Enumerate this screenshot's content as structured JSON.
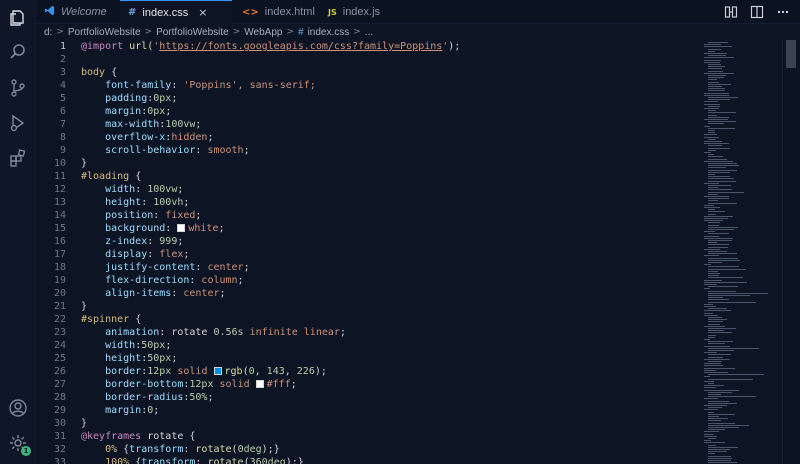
{
  "tabs": [
    {
      "label": "Welcome",
      "icon": "vscode-logo-icon"
    },
    {
      "label": "index.css",
      "icon": "css-hash-icon",
      "active": true,
      "close": "×"
    },
    {
      "label": "index.html",
      "icon": "html-brackets-icon",
      "icon_glyph": "<>"
    },
    {
      "label": "index.js",
      "icon": "js-icon",
      "icon_glyph": "JS"
    }
  ],
  "breadcrumb": [
    "d:",
    "PortfolioWebsite",
    "PortfolioWebsite",
    "WebApp",
    "index.css",
    "..."
  ],
  "breadcrumb_separator": ">",
  "breadcrumb_file_glyph": "#",
  "code": {
    "current_line": 1,
    "lines": [
      {
        "n": "1",
        "tokens": [
          [
            "@import ",
            "t-key"
          ],
          [
            "url(",
            "t-fn"
          ],
          [
            "'",
            "t-str"
          ],
          [
            "https://fonts.googleapis.com/css?family=Poppins",
            "t-url"
          ],
          [
            "'",
            "t-str"
          ],
          [
            ");",
            "t-punc"
          ]
        ]
      },
      {
        "n": "2",
        "tokens": []
      },
      {
        "n": "3",
        "tokens": [
          [
            "body",
            "t-sel"
          ],
          [
            " {",
            "t-punc"
          ]
        ]
      },
      {
        "n": "4",
        "tokens": [
          [
            "    font-family",
            "t-prop"
          ],
          [
            ": ",
            "t-punc"
          ],
          [
            "'Poppins'",
            "t-str"
          ],
          [
            ", sans-serif;",
            "t-val"
          ]
        ]
      },
      {
        "n": "5",
        "tokens": [
          [
            "    padding",
            "t-prop"
          ],
          [
            ":",
            "t-punc"
          ],
          [
            "0px",
            "t-num"
          ],
          [
            ";",
            "t-punc"
          ]
        ]
      },
      {
        "n": "6",
        "tokens": [
          [
            "    margin",
            "t-prop"
          ],
          [
            ":",
            "t-punc"
          ],
          [
            "0px",
            "t-num"
          ],
          [
            ";",
            "t-punc"
          ]
        ]
      },
      {
        "n": "7",
        "tokens": [
          [
            "    max-width",
            "t-prop"
          ],
          [
            ":",
            "t-punc"
          ],
          [
            "100vw",
            "t-num"
          ],
          [
            ";",
            "t-punc"
          ]
        ]
      },
      {
        "n": "8",
        "tokens": [
          [
            "    overflow-x",
            "t-prop"
          ],
          [
            ":",
            "t-punc"
          ],
          [
            "hidden",
            "t-val"
          ],
          [
            ";",
            "t-punc"
          ]
        ]
      },
      {
        "n": "9",
        "tokens": [
          [
            "    scroll-behavior",
            "t-prop"
          ],
          [
            ": ",
            "t-punc"
          ],
          [
            "smooth",
            "t-val"
          ],
          [
            ";",
            "t-punc"
          ]
        ]
      },
      {
        "n": "10",
        "tokens": [
          [
            "}",
            "t-punc"
          ]
        ]
      },
      {
        "n": "11",
        "tokens": [
          [
            "#loading",
            "t-sel"
          ],
          [
            " {",
            "t-punc"
          ]
        ]
      },
      {
        "n": "12",
        "tokens": [
          [
            "    width",
            "t-prop"
          ],
          [
            ": ",
            "t-punc"
          ],
          [
            "100vw",
            "t-num"
          ],
          [
            ";",
            "t-punc"
          ]
        ]
      },
      {
        "n": "13",
        "tokens": [
          [
            "    height",
            "t-prop"
          ],
          [
            ": ",
            "t-punc"
          ],
          [
            "100vh",
            "t-num"
          ],
          [
            ";",
            "t-punc"
          ]
        ]
      },
      {
        "n": "14",
        "tokens": [
          [
            "    position",
            "t-prop"
          ],
          [
            ": ",
            "t-punc"
          ],
          [
            "fixed",
            "t-val"
          ],
          [
            ";",
            "t-punc"
          ]
        ]
      },
      {
        "n": "15",
        "tokens": [
          [
            "    background",
            "t-prop"
          ],
          [
            ": ",
            "t-punc"
          ],
          [
            "#swatch:#ffffff",
            "swatch"
          ],
          [
            "white",
            "t-val"
          ],
          [
            ";",
            "t-punc"
          ]
        ]
      },
      {
        "n": "16",
        "tokens": [
          [
            "    z-index",
            "t-prop"
          ],
          [
            ": ",
            "t-punc"
          ],
          [
            "999",
            "t-num"
          ],
          [
            ";",
            "t-punc"
          ]
        ]
      },
      {
        "n": "17",
        "tokens": [
          [
            "    display",
            "t-prop"
          ],
          [
            ": ",
            "t-punc"
          ],
          [
            "flex",
            "t-val"
          ],
          [
            ";",
            "t-punc"
          ]
        ]
      },
      {
        "n": "18",
        "tokens": [
          [
            "    justify-content",
            "t-prop"
          ],
          [
            ": ",
            "t-punc"
          ],
          [
            "center",
            "t-val"
          ],
          [
            ";",
            "t-punc"
          ]
        ]
      },
      {
        "n": "19",
        "tokens": [
          [
            "    flex-direction",
            "t-prop"
          ],
          [
            ": ",
            "t-punc"
          ],
          [
            "column",
            "t-val"
          ],
          [
            ";",
            "t-punc"
          ]
        ]
      },
      {
        "n": "20",
        "tokens": [
          [
            "    align-items",
            "t-prop"
          ],
          [
            ": ",
            "t-punc"
          ],
          [
            "center",
            "t-val"
          ],
          [
            ";",
            "t-punc"
          ]
        ]
      },
      {
        "n": "21",
        "tokens": [
          [
            "}",
            "t-punc"
          ]
        ]
      },
      {
        "n": "22",
        "tokens": [
          [
            "#spinner",
            "t-sel"
          ],
          [
            " {",
            "t-punc"
          ]
        ]
      },
      {
        "n": "23",
        "tokens": [
          [
            "    animation",
            "t-prop"
          ],
          [
            ": ",
            "t-punc"
          ],
          [
            "rotate",
            "t-punc"
          ],
          [
            " 0.56s",
            "t-num"
          ],
          [
            " infinite linear",
            "t-val"
          ],
          [
            ";",
            "t-punc"
          ]
        ]
      },
      {
        "n": "24",
        "tokens": [
          [
            "    width",
            "t-prop"
          ],
          [
            ":",
            "t-punc"
          ],
          [
            "50px",
            "t-num"
          ],
          [
            ";",
            "t-punc"
          ]
        ]
      },
      {
        "n": "25",
        "tokens": [
          [
            "    height",
            "t-prop"
          ],
          [
            ":",
            "t-punc"
          ],
          [
            "50px",
            "t-num"
          ],
          [
            ";",
            "t-punc"
          ]
        ]
      },
      {
        "n": "26",
        "tokens": [
          [
            "    border",
            "t-prop"
          ],
          [
            ":",
            "t-punc"
          ],
          [
            "12px",
            "t-num"
          ],
          [
            " solid ",
            "t-val"
          ],
          [
            "#swatch:#008fe2",
            "swatch"
          ],
          [
            "rgb",
            "t-fn"
          ],
          [
            "(",
            "t-punc"
          ],
          [
            "0",
            "t-num"
          ],
          [
            ", ",
            "t-punc"
          ],
          [
            "143",
            "t-num"
          ],
          [
            ", ",
            "t-punc"
          ],
          [
            "226",
            "t-num"
          ],
          [
            ");",
            "t-punc"
          ]
        ]
      },
      {
        "n": "27",
        "tokens": [
          [
            "    border-bottom",
            "t-prop"
          ],
          [
            ":",
            "t-punc"
          ],
          [
            "12px",
            "t-num"
          ],
          [
            " solid ",
            "t-val"
          ],
          [
            "#swatch:#ffffff",
            "swatch"
          ],
          [
            "#fff",
            "t-val"
          ],
          [
            ";",
            "t-punc"
          ]
        ]
      },
      {
        "n": "28",
        "tokens": [
          [
            "    border-radius",
            "t-prop"
          ],
          [
            ":",
            "t-punc"
          ],
          [
            "50%",
            "t-num"
          ],
          [
            ";",
            "t-punc"
          ]
        ]
      },
      {
        "n": "29",
        "tokens": [
          [
            "    margin",
            "t-prop"
          ],
          [
            ":",
            "t-punc"
          ],
          [
            "0",
            "t-num"
          ],
          [
            ";",
            "t-punc"
          ]
        ]
      },
      {
        "n": "30",
        "tokens": [
          [
            "}",
            "t-punc"
          ]
        ]
      },
      {
        "n": "31",
        "tokens": [
          [
            "@keyframes",
            "t-key"
          ],
          [
            " rotate ",
            "t-punc"
          ],
          [
            "{",
            "t-punc"
          ]
        ]
      },
      {
        "n": "32",
        "tokens": [
          [
            "    0%",
            "t-sel"
          ],
          [
            " {",
            "t-punc"
          ],
          [
            "transform",
            "t-prop"
          ],
          [
            ": ",
            "t-punc"
          ],
          [
            "rotate",
            "t-fn"
          ],
          [
            "(",
            "t-punc"
          ],
          [
            "0deg",
            "t-num"
          ],
          [
            ");}",
            "t-punc"
          ]
        ]
      },
      {
        "n": "33",
        "tokens": [
          [
            "    100%",
            "t-sel"
          ],
          [
            " {",
            "t-punc"
          ],
          [
            "transform",
            "t-prop"
          ],
          [
            ": ",
            "t-punc"
          ],
          [
            "rotate",
            "t-fn"
          ],
          [
            "(",
            "t-punc"
          ],
          [
            "360deg",
            "t-num"
          ],
          [
            ");}",
            "t-punc"
          ]
        ]
      }
    ]
  },
  "activity_icons": [
    "explorer-icon",
    "search-icon",
    "source-control-icon",
    "run-debug-icon",
    "extensions-icon",
    "account-icon",
    "settings-gear-icon"
  ],
  "settings_badge": "1",
  "colors": {
    "accent": "#3794ff",
    "background": "#0d1525",
    "selector": "#d7ba7d",
    "property": "#9cdcfe",
    "value": "#ce9178",
    "number": "#b5cea8",
    "keyword": "#c586c0",
    "function": "#dcdcaa"
  }
}
